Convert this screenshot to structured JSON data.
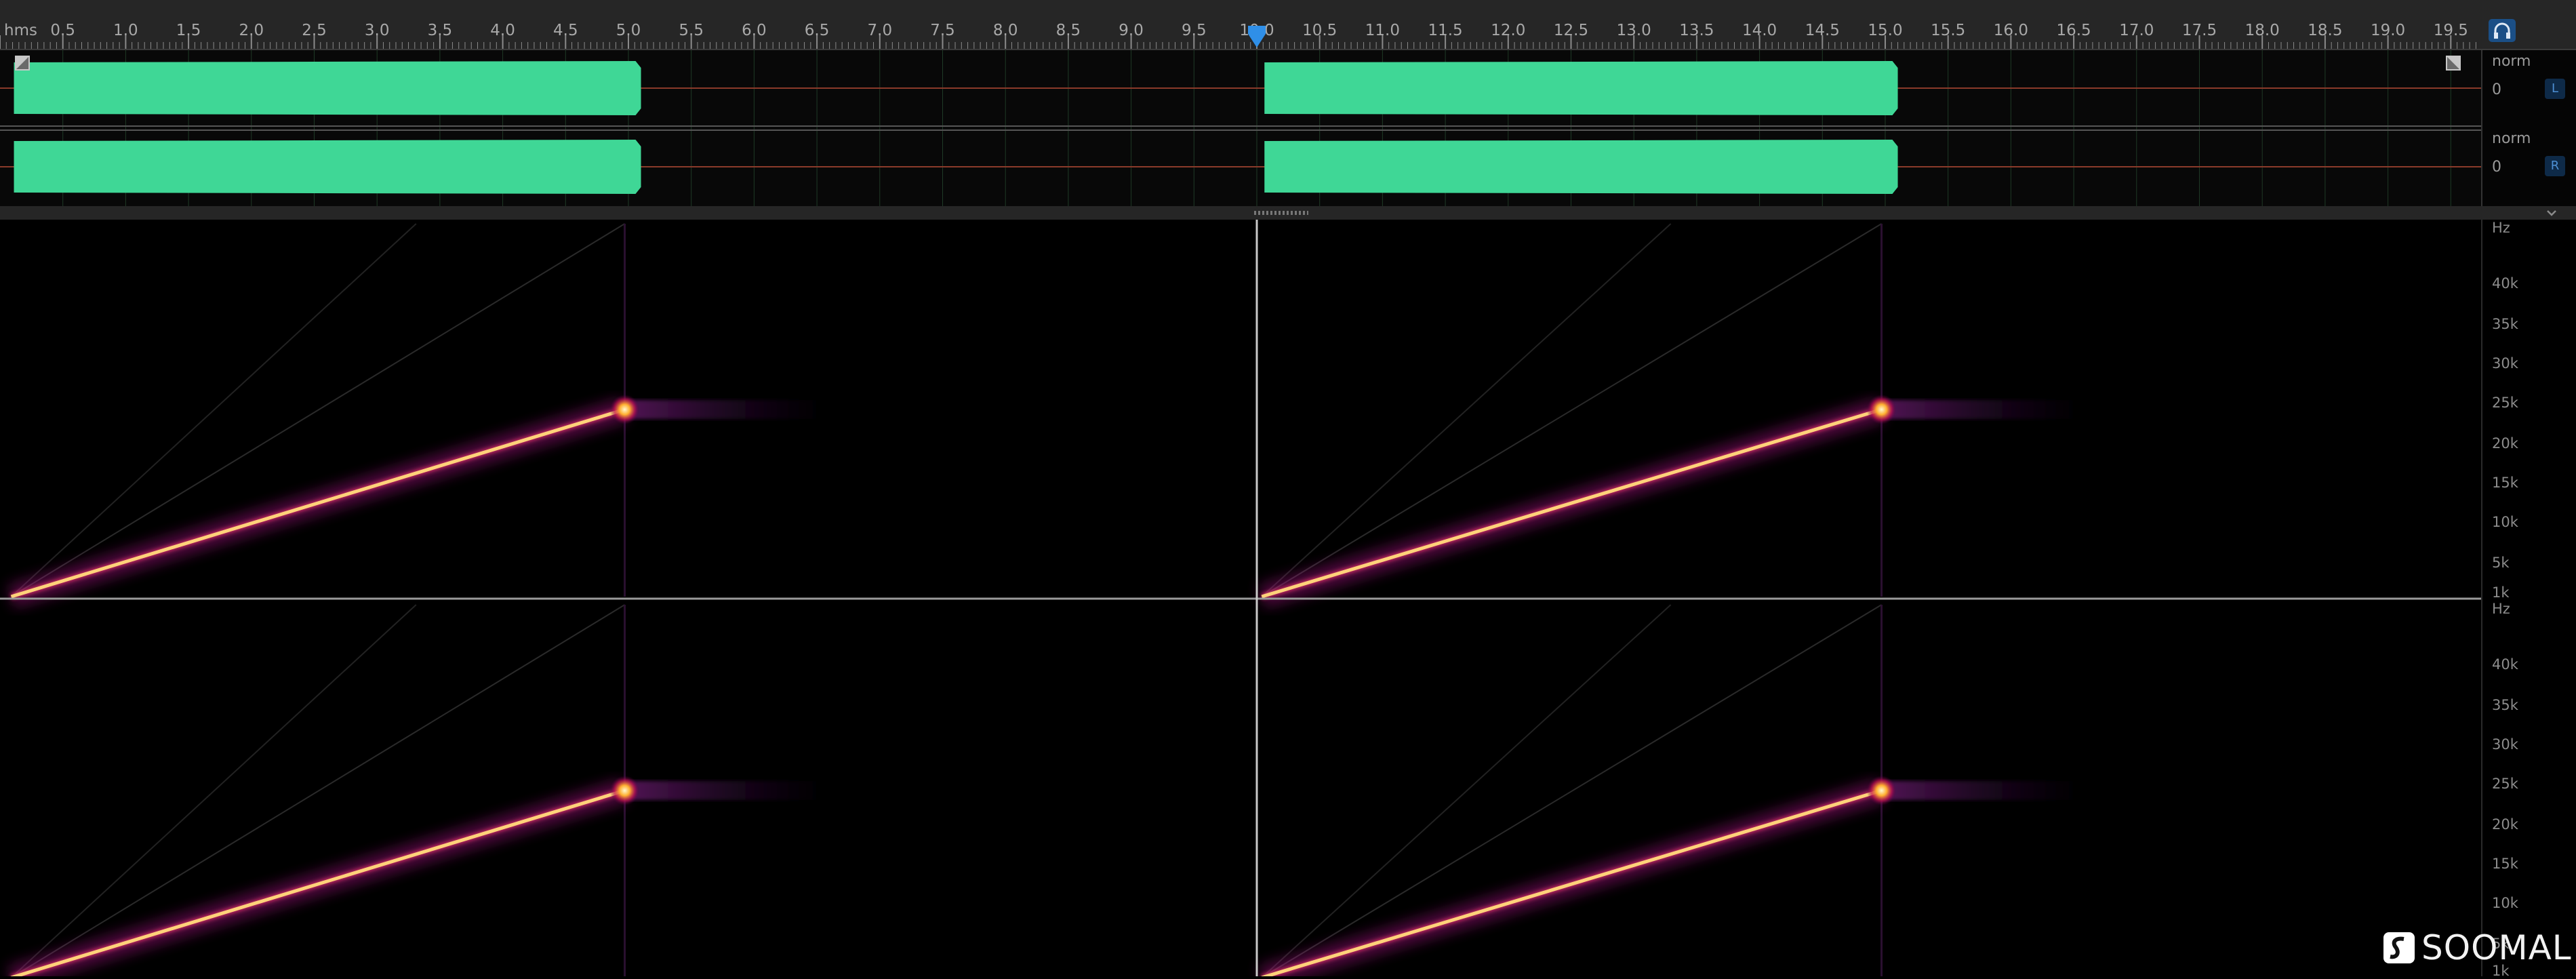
{
  "ruler": {
    "unit_label": "hms",
    "ticks": [
      "0.5",
      "1.0",
      "1.5",
      "2.0",
      "2.5",
      "3.0",
      "3.5",
      "4.0",
      "4.5",
      "5.0",
      "5.5",
      "6.0",
      "6.5",
      "7.0",
      "7.5",
      "8.0",
      "8.5",
      "9.0",
      "9.5",
      "10.0",
      "10.5",
      "11.0",
      "11.5",
      "12.0",
      "12.5",
      "13.0",
      "13.5",
      "14.0",
      "14.5",
      "15.0",
      "15.5",
      "16.0",
      "16.5",
      "17.0",
      "17.5",
      "18.0",
      "18.5",
      "19.0",
      "19.5"
    ],
    "playhead_seconds": 10.0
  },
  "waveform": {
    "channels": [
      {
        "scale_label": "norm",
        "zero_label": "0",
        "badge": "L"
      },
      {
        "scale_label": "norm",
        "zero_label": "0",
        "badge": "R"
      }
    ],
    "segments_seconds": [
      [
        0.1,
        5.1
      ],
      [
        10.05,
        15.1
      ]
    ],
    "wave_color": "#3fd796"
  },
  "spectrogram": {
    "unit_label": "Hz",
    "freq_labels": [
      "40k",
      "35k",
      "30k",
      "25k",
      "20k",
      "15k",
      "10k",
      "5k",
      "1k"
    ]
  },
  "colors": {
    "accent": "#2f8fe8",
    "sweep": "#ffd27a",
    "glow": "#b0178a"
  },
  "watermark": {
    "text": "SOOMAL"
  }
}
